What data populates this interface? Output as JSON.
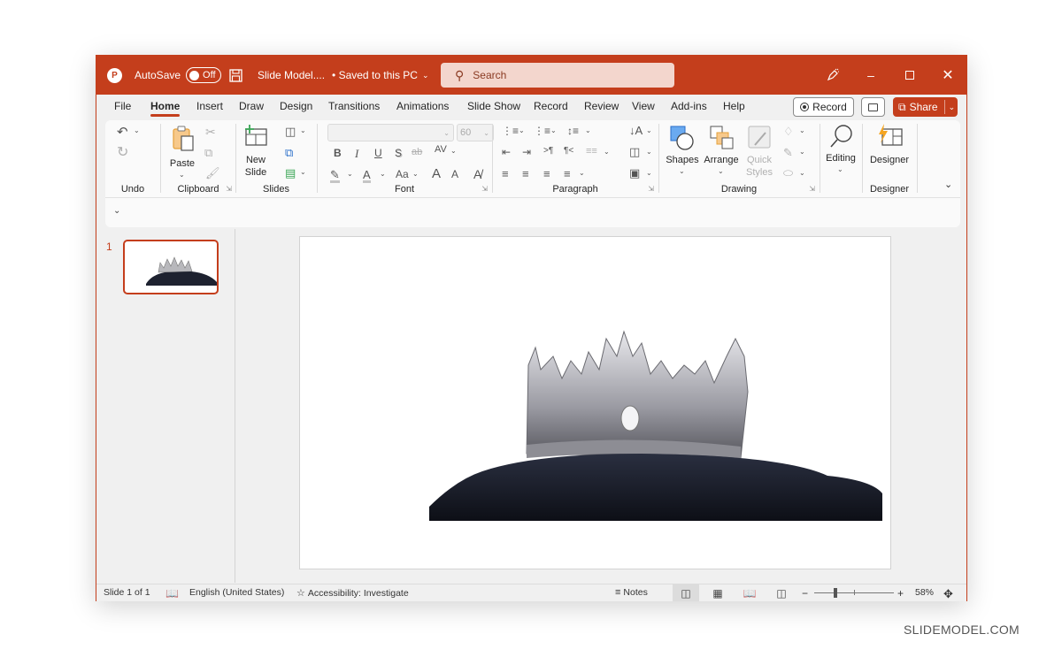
{
  "titlebar": {
    "app_icon": "powerpoint-logo-icon",
    "autosave_label": "AutoSave",
    "autosave_state": "Off",
    "save_icon": "save-icon",
    "doc_title": "Slide Model....",
    "save_status": "• Saved to this PC",
    "search_placeholder": "Search",
    "controls": [
      "pen-icon",
      "minimize-icon",
      "maximize-icon",
      "close-icon"
    ]
  },
  "tabs": [
    {
      "label": "File",
      "active": false
    },
    {
      "label": "Home",
      "active": true
    },
    {
      "label": "Insert",
      "active": false
    },
    {
      "label": "Draw",
      "active": false
    },
    {
      "label": "Design",
      "active": false
    },
    {
      "label": "Transitions",
      "active": false
    },
    {
      "label": "Animations",
      "active": false
    },
    {
      "label": "Slide Show",
      "active": false
    },
    {
      "label": "Record",
      "active": false
    },
    {
      "label": "Review",
      "active": false
    },
    {
      "label": "View",
      "active": false
    },
    {
      "label": "Add-ins",
      "active": false
    },
    {
      "label": "Help",
      "active": false
    }
  ],
  "tab_actions": {
    "record_label": "Record",
    "share_label": "Share"
  },
  "ribbon": {
    "groups": {
      "undo": {
        "label": "Undo"
      },
      "clipboard": {
        "label": "Clipboard",
        "paste_label": "Paste"
      },
      "slides": {
        "label": "Slides",
        "new_slide_line1": "New",
        "new_slide_line2": "Slide"
      },
      "font": {
        "label": "Font",
        "font_name": "",
        "font_size": "60",
        "bold": "B",
        "italic": "I",
        "underline": "U",
        "shadow": "S",
        "strike": "ab",
        "spacing": "AV",
        "case": "Aa",
        "grow": "A",
        "shrink": "A"
      },
      "paragraph": {
        "label": "Paragraph"
      },
      "drawing": {
        "label": "Drawing",
        "shapes_label": "Shapes",
        "arrange_label": "Arrange",
        "quick_styles_line1": "Quick",
        "quick_styles_line2": "Styles"
      },
      "editing": {
        "label": "Editing"
      },
      "designer": {
        "label": "Designer",
        "button_label": "Designer"
      }
    }
  },
  "thumbnails": [
    {
      "number": "1",
      "selected": true
    }
  ],
  "statusbar": {
    "slide_info": "Slide 1 of 1",
    "language": "English (United States)",
    "accessibility": "Accessibility: Investigate",
    "notes_label": "Notes",
    "zoom_percent": "58%",
    "zoom_value": 58
  },
  "watermark": "SLIDEMODEL.COM",
  "colors": {
    "accent": "#c43e1c",
    "search_bg": "#f3d6cd"
  }
}
